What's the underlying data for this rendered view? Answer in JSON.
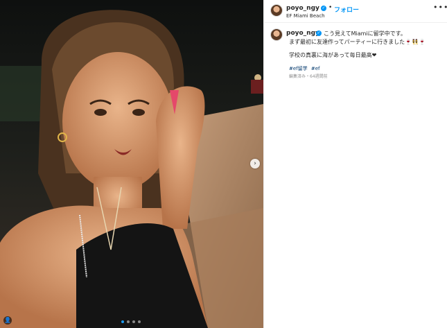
{
  "header": {
    "username": "poyo_ngy",
    "separator": "•",
    "follow_label": "フォロー",
    "location": "EF Miami Beach",
    "more_icon": "more-horizontal-icon"
  },
  "caption": {
    "username": "poyo_ngy",
    "line1": "こう見えてMiamiに留学中です。",
    "line2": "まず最初に友達作ってパーティーに行きました🍷👯‍♀️🍷",
    "line3": "学校の真裏に海があって毎日最高❤",
    "hashtags": [
      "#ef留学",
      "#ef"
    ],
    "meta": "編集済み・64週間前"
  },
  "media": {
    "next_icon": "chevron-right-icon",
    "next_glyph": "›",
    "carousel_count": 4,
    "carousel_active": 1,
    "corner_glyph": "👤"
  },
  "colors": {
    "accent": "#0095f6",
    "active_dot": "#1d9bf0",
    "text": "#262626",
    "muted": "#8e8e8e"
  }
}
